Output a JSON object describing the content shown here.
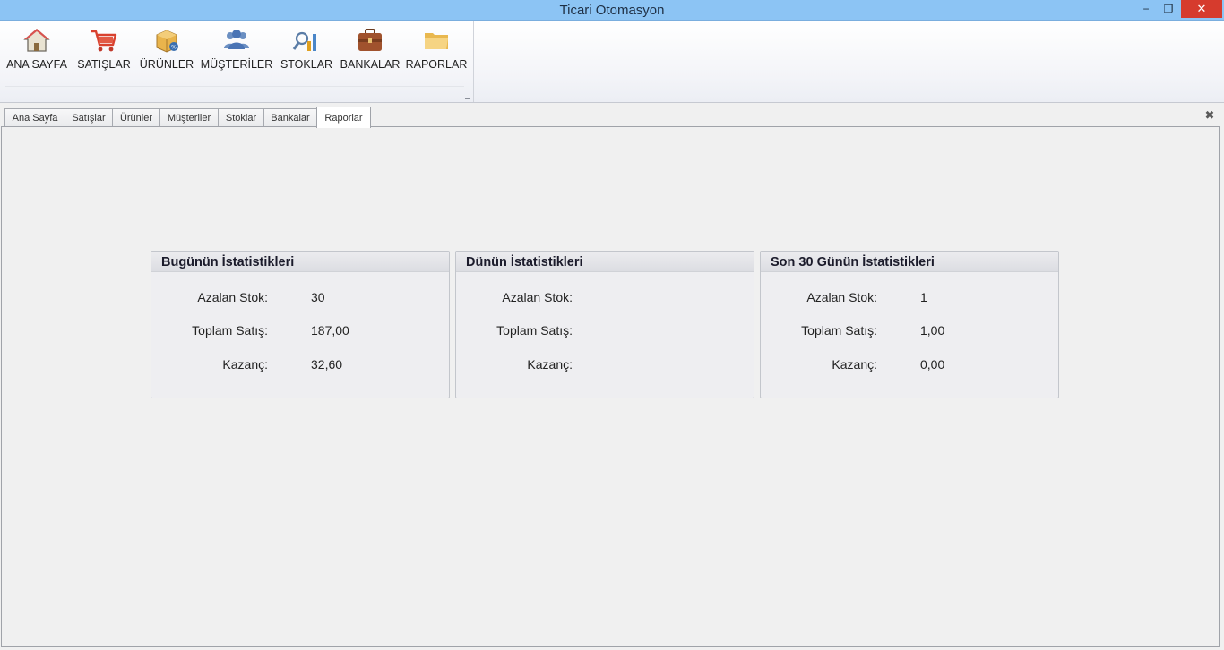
{
  "window": {
    "title": "Ticari Otomasyon",
    "min_label": "−",
    "max_label": "❐",
    "close_label": "✕"
  },
  "ribbon": {
    "buttons": [
      {
        "label": "ANA SAYFA",
        "icon": "home-icon"
      },
      {
        "label": "SATIŞLAR",
        "icon": "cart-icon"
      },
      {
        "label": "ÜRÜNLER",
        "icon": "box-icon"
      },
      {
        "label": "MÜŞTERİLER",
        "icon": "users-icon"
      },
      {
        "label": "STOKLAR",
        "icon": "stock-chart-icon"
      },
      {
        "label": "BANKALAR",
        "icon": "briefcase-icon"
      },
      {
        "label": "RAPORLAR",
        "icon": "folder-icon"
      }
    ]
  },
  "tabs": [
    {
      "label": "Ana Sayfa"
    },
    {
      "label": "Satışlar"
    },
    {
      "label": "Ürünler"
    },
    {
      "label": "Müşteriler"
    },
    {
      "label": "Stoklar"
    },
    {
      "label": "Bankalar"
    },
    {
      "label": "Raporlar",
      "active": true
    }
  ],
  "tab_close": "✖",
  "panels": [
    {
      "title": "Bugünün İstatistikleri",
      "rows": [
        {
          "label": "Azalan Stok:",
          "value": "30"
        },
        {
          "label": "Toplam Satış:",
          "value": "187,00"
        },
        {
          "label": "Kazanç:",
          "value": "32,60"
        }
      ]
    },
    {
      "title": "Dünün İstatistikleri",
      "rows": [
        {
          "label": "Azalan Stok:",
          "value": ""
        },
        {
          "label": "Toplam Satış:",
          "value": ""
        },
        {
          "label": "Kazanç:",
          "value": ""
        }
      ]
    },
    {
      "title": "Son 30 Günün İstatistikleri",
      "rows": [
        {
          "label": "Azalan Stok:",
          "value": "1"
        },
        {
          "label": "Toplam Satış:",
          "value": "1,00"
        },
        {
          "label": "Kazanç:",
          "value": "0,00"
        }
      ]
    }
  ],
  "colors": {
    "titlebar": "#8cc4f4",
    "close_button": "#d63b2d"
  }
}
